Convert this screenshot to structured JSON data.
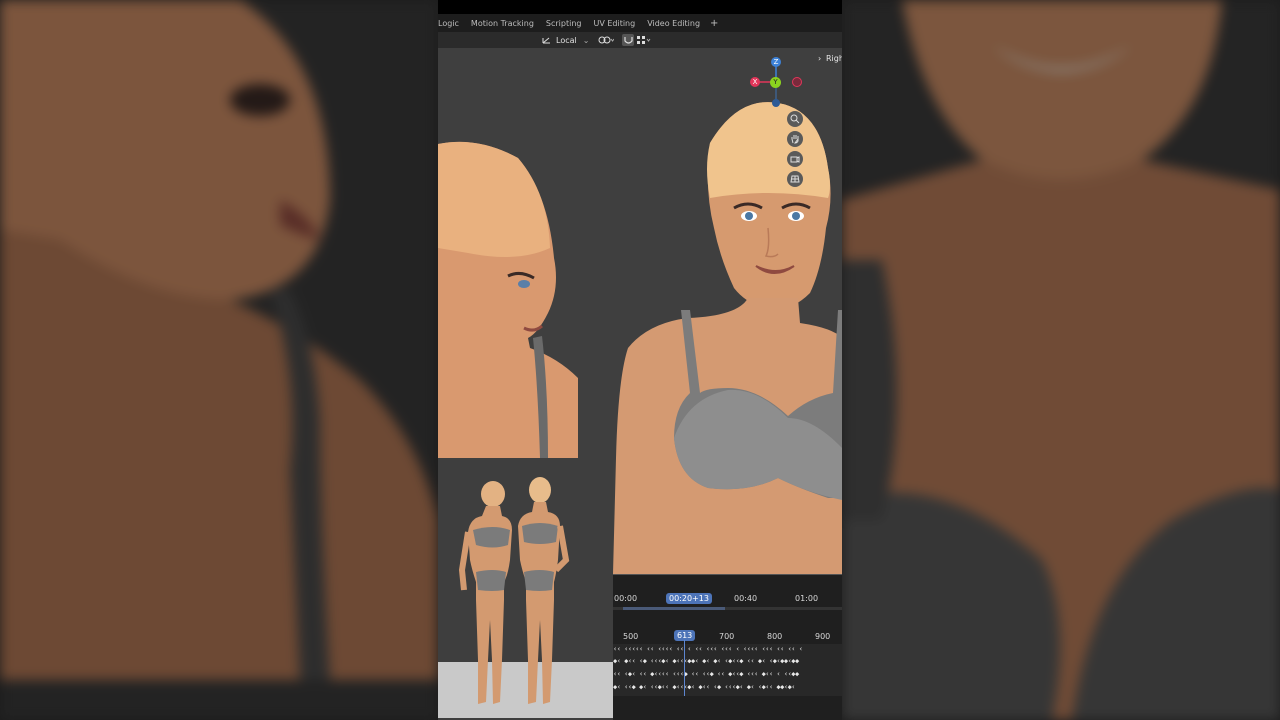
{
  "workspace_tabs": [
    "Logic",
    "Motion Tracking",
    "Scripting",
    "UV Editing",
    "Video Editing"
  ],
  "add_tab": "+",
  "toolbar": {
    "orientation": "Local",
    "orientation_chevron": "⌄"
  },
  "viewport": {
    "view_label": "Righ",
    "gizmo": {
      "z": "Z",
      "y": "Y",
      "x": "X"
    },
    "nav_icons": [
      "zoom-icon",
      "pan-hand-icon",
      "camera-icon",
      "grid-perspective-icon"
    ]
  },
  "timeline": {
    "time_ticks": [
      "00:00",
      "00:40",
      "01:00"
    ],
    "current_time": "00:20+13",
    "frame_ticks": [
      "500",
      "700",
      "800",
      "900"
    ],
    "current_frame": "613",
    "key_rows": [
      "‹‹ ‹‹‹‹‹ ‹‹ ‹‹‹‹ ‹‹ ‹ ‹‹ ‹‹‹ ‹‹‹ ‹ ‹‹‹‹ ‹‹‹ ‹‹ ‹‹ ‹",
      "◆‹ ◆‹‹ ‹◆ ‹‹‹◆‹ ◆‹‹‹◆◆‹ ◆‹ ◆‹ ‹◆‹‹◆ ‹‹ ◆‹ ‹◆‹◆◆‹◆◆",
      "‹‹ ‹◆‹ ‹‹ ◆‹‹‹‹ ‹‹‹◆ ‹‹ ‹‹◆ ‹‹ ◆‹‹◆ ‹‹‹ ◆‹‹ ‹ ‹‹◆◆",
      "◆‹ ‹‹◆ ◆‹ ‹‹◆‹‹ ◆‹‹‹◆‹ ◆‹‹ ‹◆ ‹‹‹◆‹ ◆‹ ‹◆‹‹ ◆◆‹◆‹"
    ]
  },
  "colors": {
    "axis_x": "#e2365a",
    "axis_y": "#8bd21f",
    "axis_z": "#3d82d8",
    "accent": "#4d74b8"
  }
}
